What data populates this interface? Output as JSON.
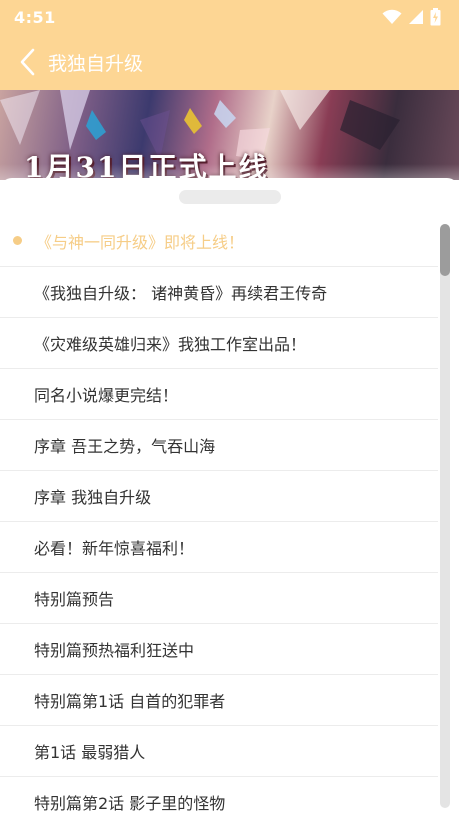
{
  "status_bar": {
    "time": "4:51",
    "icons": [
      "wifi-icon",
      "signal-icon",
      "battery-charging-icon"
    ]
  },
  "app_bar": {
    "title": "我独自升级",
    "back_icon": "chevron-left-icon"
  },
  "banner": {
    "caption": "1月31日正式上线"
  },
  "chapters": [
    {
      "label": "《与神一同升级》即将上线！",
      "active": true
    },
    {
      "label": "《我独自升级： 诸神黄昏》再续君王传奇",
      "active": false
    },
    {
      "label": "《灾难级英雄归来》我独工作室出品！",
      "active": false
    },
    {
      "label": "同名小说爆更完结！",
      "active": false
    },
    {
      "label": "序章 吾王之势，气吞山海",
      "active": false
    },
    {
      "label": "序章 我独自升级",
      "active": false
    },
    {
      "label": "必看！新年惊喜福利！",
      "active": false
    },
    {
      "label": "特别篇预告",
      "active": false
    },
    {
      "label": "特别篇预热福利狂送中",
      "active": false
    },
    {
      "label": "特别篇第1话 自首的犯罪者",
      "active": false
    },
    {
      "label": "第1话 最弱猎人",
      "active": false
    },
    {
      "label": "特别篇第2话 影子里的怪物",
      "active": false
    }
  ],
  "colors": {
    "accent": "#fdd694",
    "active_text": "#f6cd87",
    "text": "#333333"
  }
}
